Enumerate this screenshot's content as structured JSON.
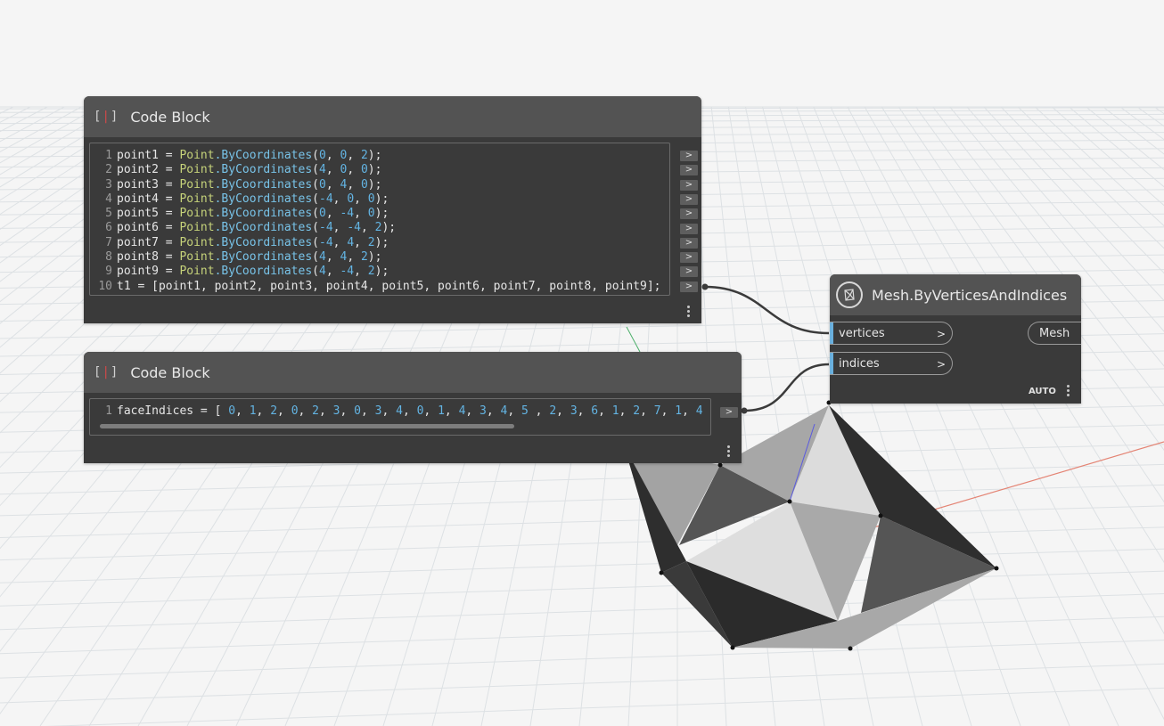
{
  "code_block_1": {
    "title": "Code Block",
    "lines": [
      {
        "num": "1",
        "var": "point1",
        "eq": " = ",
        "cls": "Point",
        "fn": ".ByCoordinates",
        "args": [
          "0",
          "0",
          "2"
        ],
        "tail": ");"
      },
      {
        "num": "2",
        "var": "point2",
        "eq": " = ",
        "cls": "Point",
        "fn": ".ByCoordinates",
        "args": [
          "4",
          "0",
          "0"
        ],
        "tail": ");"
      },
      {
        "num": "3",
        "var": "point3",
        "eq": " = ",
        "cls": "Point",
        "fn": ".ByCoordinates",
        "args": [
          "0",
          "4",
          "0"
        ],
        "tail": ");"
      },
      {
        "num": "4",
        "var": "point4",
        "eq": " = ",
        "cls": "Point",
        "fn": ".ByCoordinates",
        "args": [
          "-4",
          "0",
          "0"
        ],
        "tail": ");"
      },
      {
        "num": "5",
        "var": "point5",
        "eq": " = ",
        "cls": "Point",
        "fn": ".ByCoordinates",
        "args": [
          "0",
          "-4",
          "0"
        ],
        "tail": ");"
      },
      {
        "num": "6",
        "var": "point6",
        "eq": " = ",
        "cls": "Point",
        "fn": ".ByCoordinates",
        "args": [
          "-4",
          "-4",
          "2"
        ],
        "tail": ");"
      },
      {
        "num": "7",
        "var": "point7",
        "eq": " = ",
        "cls": "Point",
        "fn": ".ByCoordinates",
        "args": [
          "-4",
          "4",
          "2"
        ],
        "tail": ");"
      },
      {
        "num": "8",
        "var": "point8",
        "eq": " = ",
        "cls": "Point",
        "fn": ".ByCoordinates",
        "args": [
          "4",
          "4",
          "2"
        ],
        "tail": ");"
      },
      {
        "num": "9",
        "var": "point9",
        "eq": " = ",
        "cls": "Point",
        "fn": ".ByCoordinates",
        "args": [
          "4",
          "-4",
          "2"
        ],
        "tail": ");"
      }
    ],
    "line10": {
      "num": "10",
      "text": "t1 = [point1, point2, point3, point4, point5, point6, point7, point8, point9];"
    },
    "output_label": ">"
  },
  "code_block_2": {
    "title": "Code Block",
    "line_num": "1",
    "prefix": "faceIndices = [ ",
    "values": [
      "0",
      "1",
      "2",
      "0",
      "2",
      "3",
      "0",
      "3",
      "4",
      "0",
      "1",
      "4",
      "3",
      "4",
      "5 ",
      "2",
      "3",
      "6",
      "1",
      "2",
      "7",
      "1",
      "4"
    ],
    "output_label": ">"
  },
  "mesh_node": {
    "title": "Mesh.ByVerticesAndIndices",
    "inputs": [
      {
        "label": "vertices",
        "chevron": ">"
      },
      {
        "label": "indices",
        "chevron": ">"
      }
    ],
    "output": "Mesh",
    "lacing": "AUTO",
    "icon": "mesh-node-icon"
  },
  "colors": {
    "canvas_bg": "#f5f5f5",
    "grid_line": "#d9dde0",
    "node_body": "#3a3a3a",
    "node_header": "#535353",
    "port_accent": "#6ab0de",
    "wire": "#3b3b3b",
    "axis_x": "#e07060",
    "axis_y": "#4caf6a",
    "axis_z": "#5a5ae0"
  }
}
